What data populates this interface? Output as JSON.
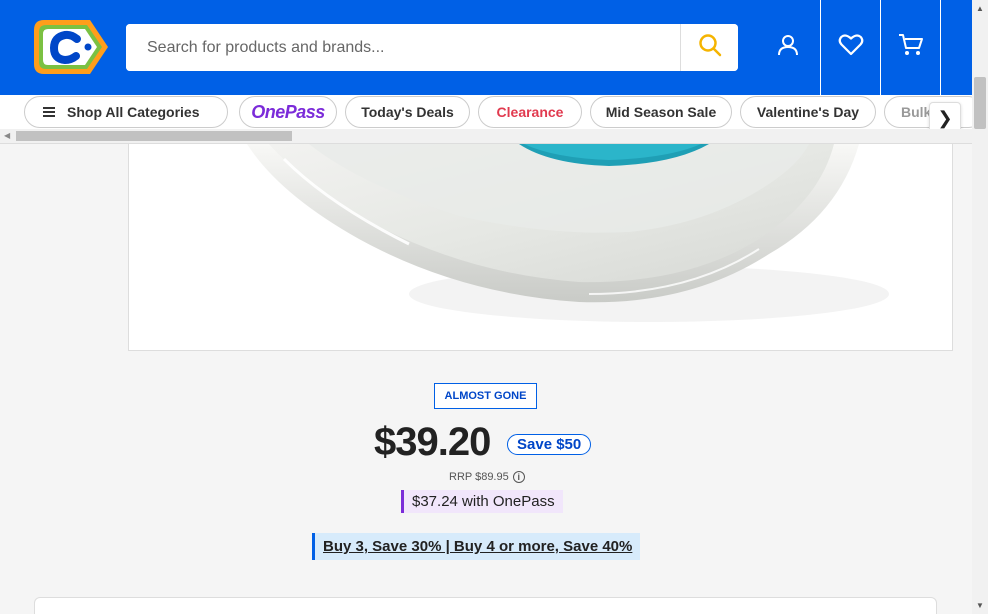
{
  "header": {
    "search_placeholder": "Search for products and brands...",
    "colors": {
      "header_bg": "#0060e6",
      "accent_yellow": "#f5b400"
    },
    "icons": [
      "search-icon",
      "user-icon",
      "heart-icon",
      "cart-icon"
    ]
  },
  "nav": {
    "shop_all": "Shop All Categories",
    "items": [
      "OnePass",
      "Today's Deals",
      "Clearance",
      "Mid Season Sale",
      "Valentine's Day",
      "Bulk"
    ],
    "next": "❯"
  },
  "product": {
    "badge": "ALMOST GONE",
    "price": "$39.20",
    "save": "Save $50",
    "rrp": "RRP $89.95",
    "onepass_price": "$37.24 with OnePass",
    "promo": "Buy 3, Save 30% | Buy 4 or more, Save 40%"
  }
}
